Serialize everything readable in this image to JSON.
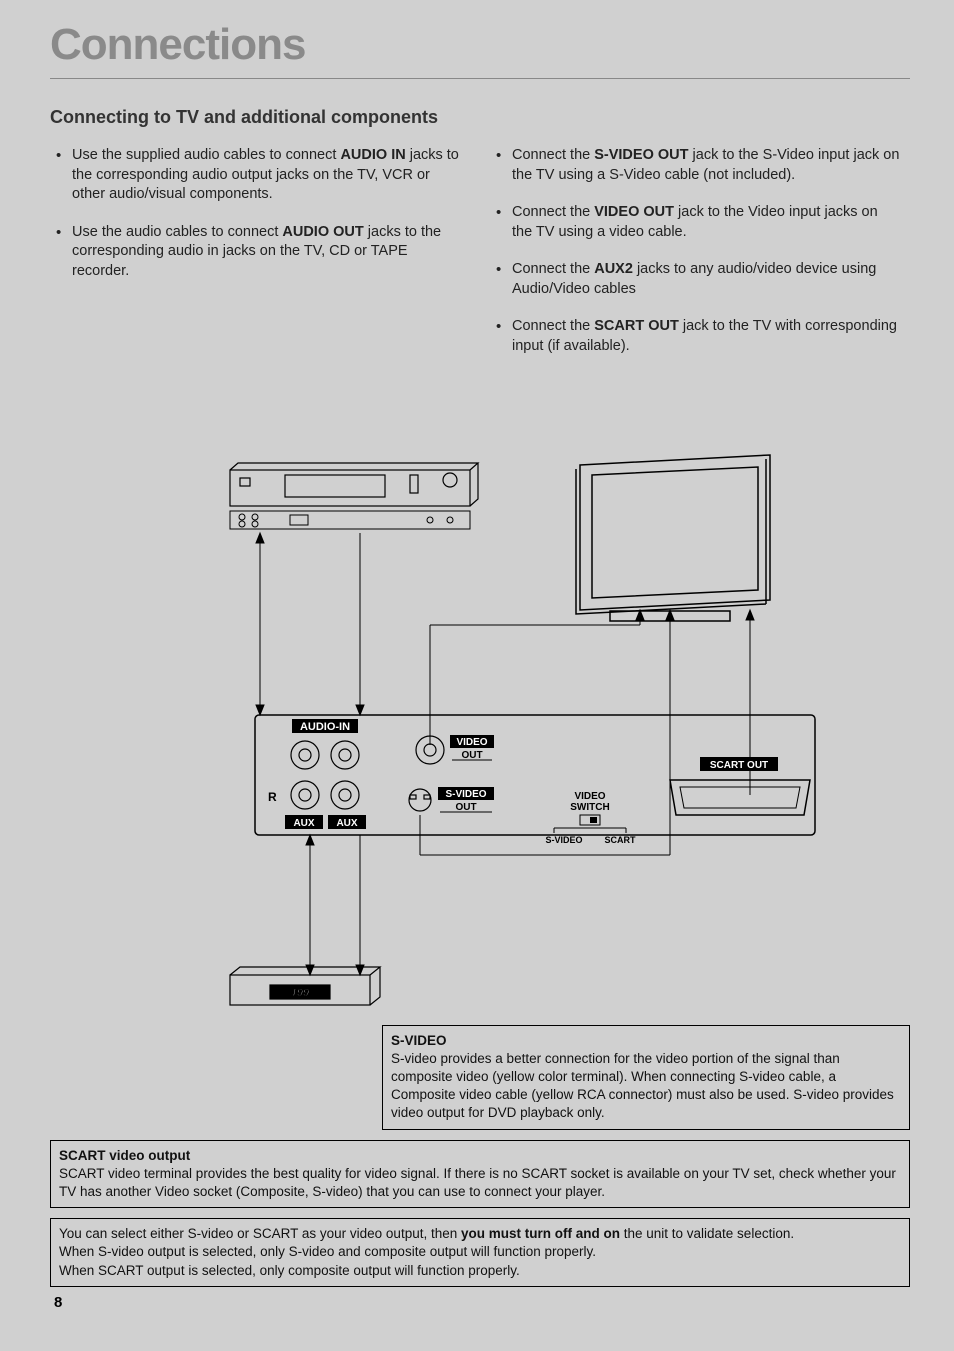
{
  "title": "Connections",
  "subtitle": "Connecting to TV and additional components",
  "left_bullets": [
    {
      "pre": "Use the supplied audio cables to connect ",
      "bold": "AUDIO IN",
      "post": " jacks to the corresponding audio output jacks on the TV, VCR or other audio/visual components."
    },
    {
      "pre": "Use the audio cables to connect ",
      "bold": "AUDIO OUT",
      "post": " jacks to the corresponding audio in jacks on the TV, CD or TAPE recorder."
    }
  ],
  "right_bullets": [
    {
      "pre": "Connect the ",
      "bold": "S-VIDEO OUT",
      "post": " jack to the S-Video input jack on the TV using a S-Video cable (not included)."
    },
    {
      "pre": "Connect the ",
      "bold": "VIDEO OUT",
      "post": " jack to the Video input jacks on the TV using a video cable."
    },
    {
      "pre": "Connect the ",
      "bold": "AUX2",
      "post": " jacks to any audio/video device using Audio/Video cables"
    },
    {
      "pre": "Connect the ",
      "bold": "SCART OUT",
      "post": " jack to the TV with corresponding input (if available)."
    }
  ],
  "labels": {
    "audio_in": "AUDIO-IN",
    "video_out": "VIDEO",
    "video_out2": "OUT",
    "svideo": "S-VIDEO",
    "svideo2": "OUT",
    "scart_out": "SCART OUT",
    "video_switch": "VIDEO",
    "video_switch2": "SWITCH",
    "svideo_lbl": "S-VIDEO",
    "scart_lbl": "SCART",
    "aux": "AUX",
    "r": "R",
    "dvd_199": "199"
  },
  "svideo_box": {
    "title": "S-VIDEO",
    "body": "S-video provides a better connection for the video portion of the signal than composite video (yellow color terminal). When connecting S-video cable, a Composite video cable (yellow RCA connector) must also be used. S-video provides video output for DVD playback only."
  },
  "scart_box": {
    "title": "SCART video output",
    "body": "SCART video terminal provides the best quality for video signal. If there is no SCART socket is available on your TV set, check whether your TV has another Video socket (Composite, S-video) that you can use to connect your player."
  },
  "note_box": {
    "l1a": "You can select either S-video or SCART as your video output, then ",
    "l1b": "you must turn off and on",
    "l1c": " the unit to validate selection.",
    "l2": "When S-video output is selected, only S-video and composite output will function properly.",
    "l3": "When SCART output is selected, only composite output will function properly."
  },
  "page_number": "8"
}
